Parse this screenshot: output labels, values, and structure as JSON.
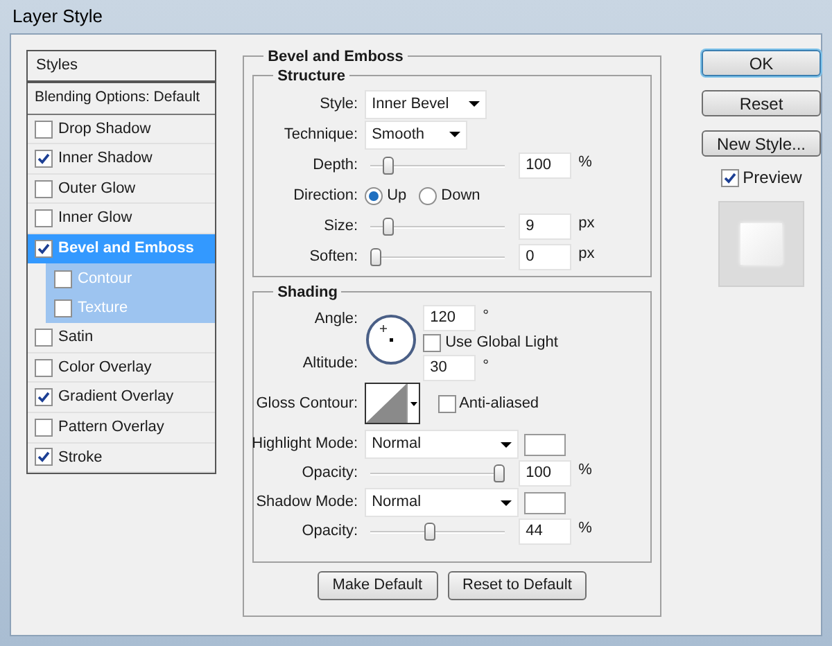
{
  "window": {
    "title": "Layer Style"
  },
  "styles_list": {
    "header": "Styles",
    "blending": "Blending Options: Default",
    "items": [
      {
        "label": "Drop Shadow",
        "checked": false,
        "selected": false
      },
      {
        "label": "Inner Shadow",
        "checked": true,
        "selected": false
      },
      {
        "label": "Outer Glow",
        "checked": false,
        "selected": false
      },
      {
        "label": "Inner Glow",
        "checked": false,
        "selected": false
      },
      {
        "label": "Bevel and Emboss",
        "checked": true,
        "selected": true,
        "children": [
          {
            "label": "Contour",
            "checked": false,
            "selected": false
          },
          {
            "label": "Texture",
            "checked": false,
            "selected": false
          }
        ]
      },
      {
        "label": "Satin",
        "checked": false,
        "selected": false
      },
      {
        "label": "Color Overlay",
        "checked": false,
        "selected": false
      },
      {
        "label": "Gradient Overlay",
        "checked": true,
        "selected": false
      },
      {
        "label": "Pattern Overlay",
        "checked": false,
        "selected": false
      },
      {
        "label": "Stroke",
        "checked": true,
        "selected": false
      }
    ]
  },
  "panel": {
    "title": "Bevel and Emboss",
    "structure": {
      "title": "Structure",
      "rows": [
        {
          "kind": "select",
          "label": "Style:",
          "value": "Inner Bevel"
        },
        {
          "kind": "select",
          "label": "Technique:",
          "value": "Smooth"
        },
        {
          "kind": "slider",
          "label": "Depth:",
          "level": 0.1,
          "value": "100",
          "unit": "%"
        },
        {
          "kind": "radio",
          "label": "Direction:",
          "options": [
            {
              "label": "Up",
              "selected": true
            },
            {
              "label": "Down",
              "selected": false
            }
          ]
        },
        {
          "kind": "slider",
          "label": "Size:",
          "level": 0.1,
          "value": "9",
          "unit": "px"
        },
        {
          "kind": "slider",
          "label": "Soften:",
          "level": 0,
          "value": "0",
          "unit": "px"
        }
      ]
    },
    "shading": {
      "title": "Shading",
      "angle": {
        "label": "Angle:",
        "value": "120",
        "unit": "°"
      },
      "use_global_light": {
        "label": "Use Global Light",
        "checked": false
      },
      "altitude": {
        "label": "Altitude:",
        "value": "30",
        "unit": "°"
      },
      "gloss_contour": {
        "label": "Gloss Contour:"
      },
      "anti_aliased": {
        "label": "Anti-aliased",
        "checked": false
      },
      "rows": [
        {
          "kind": "mode",
          "label": "Highlight Mode:",
          "value": "Normal"
        },
        {
          "kind": "slider",
          "label": "Opacity:",
          "level": 1,
          "value": "100",
          "unit": "%"
        },
        {
          "kind": "mode",
          "label": "Shadow Mode:",
          "value": "Normal"
        },
        {
          "kind": "slider",
          "label": "Opacity:",
          "level": 0.44,
          "value": "44",
          "unit": "%"
        }
      ]
    },
    "buttons": [
      "Make Default",
      "Reset to Default"
    ]
  },
  "side_buttons": [
    {
      "label": "OK",
      "default": true
    },
    {
      "label": "Reset",
      "default": false
    },
    {
      "label": "New Style...",
      "default": false
    }
  ],
  "preview": {
    "label": "Preview",
    "checked": true
  }
}
